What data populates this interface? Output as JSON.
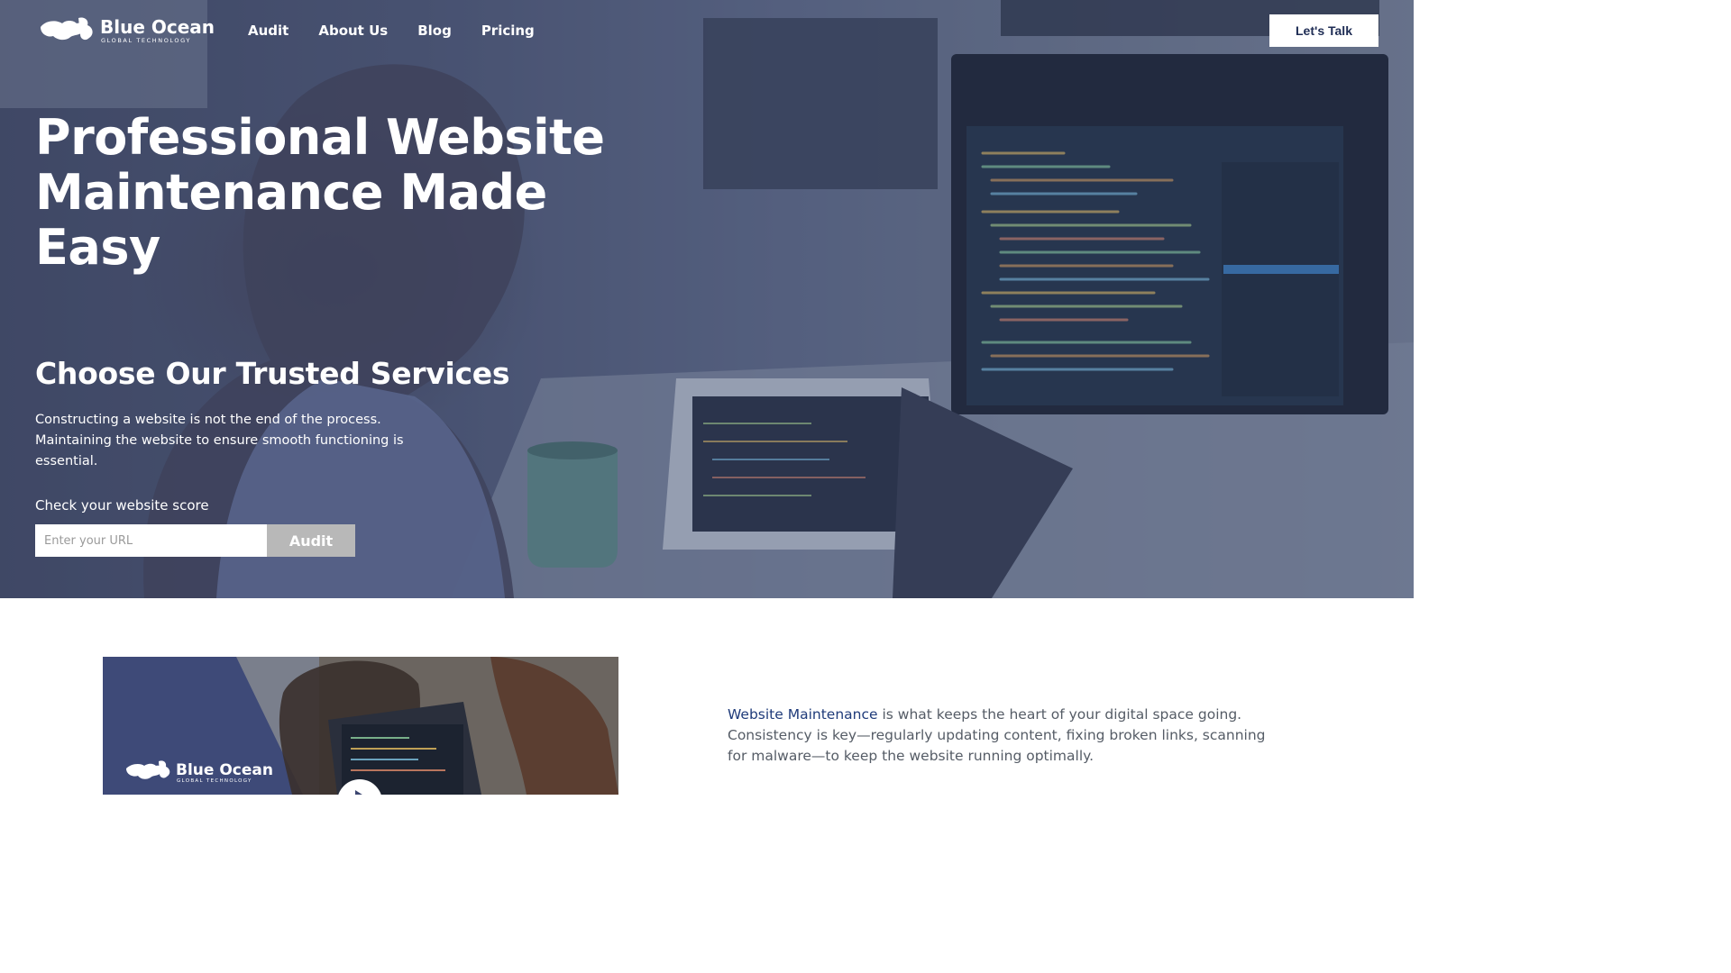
{
  "brand": {
    "name": "Blue Ocean",
    "tagline": "GLOBAL TECHNOLOGY"
  },
  "nav": {
    "items": [
      {
        "label": "Audit"
      },
      {
        "label": "About Us"
      },
      {
        "label": "Blog"
      },
      {
        "label": "Pricing"
      }
    ]
  },
  "header": {
    "cta_label": "Let's Talk"
  },
  "hero": {
    "title_line1": "Professional Website",
    "title_line2": "Maintenance Made Easy",
    "subtitle": "Choose Our Trusted Services",
    "description": "Constructing a website is not the end of the process. Maintaining the website to ensure smooth functioning is essential.",
    "score_label": "Check your website score",
    "url_placeholder": "Enter your URL",
    "audit_button": "Audit"
  },
  "about": {
    "link_text": "Website Maintenance",
    "text": " is what keeps the heart of your digital space going. Consistency is key—regularly updating content, fixing broken links, scanning for malware—to keep the website running optimally."
  },
  "colors": {
    "accent": "#1e2c54",
    "link": "#1f3b7a",
    "hero_overlay": "#2c3a60",
    "audit_button": "#b8b8b8"
  }
}
